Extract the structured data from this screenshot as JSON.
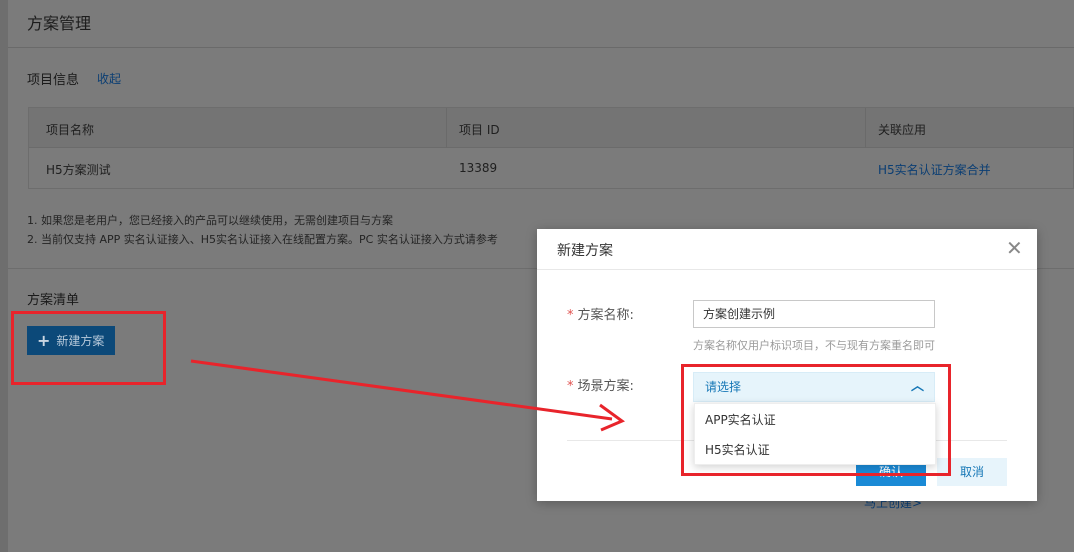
{
  "page": {
    "title": "方案管理",
    "project_section_title": "项目信息",
    "collapse_label": "收起",
    "project_table": {
      "headers": [
        "项目名称",
        "项目 ID",
        "关联应用"
      ],
      "rows": [
        {
          "name": "H5方案测试",
          "id": "13389",
          "app": "H5实名认证方案合并"
        }
      ]
    },
    "notes": [
      "1. 如果您是老用户，您已经接入的产品可以继续使用，无需创建项目与方案",
      "2. 当前仅支持 APP 实名认证接入、H5实名认证接入在线配置方案。PC 实名认证接入方式请参考"
    ],
    "plan_list_title": "方案清单",
    "new_plan_button": "新建方案",
    "bottom_link": "马上创建>"
  },
  "modal": {
    "title": "新建方案",
    "close_icon": "close-icon",
    "name_label": "方案名称:",
    "name_value": "方案创建示例",
    "name_hint": "方案名称仅用户标识项目，不与现有方案重名即可",
    "scene_label": "场景方案:",
    "scene_placeholder": "请选择",
    "ok_label": "确认",
    "cancel_label": "取消"
  },
  "dropdown": {
    "options": [
      "APP实名认证",
      "H5实名认证"
    ]
  },
  "colors": {
    "annotation_red": "#e8242b",
    "link_blue": "#1677b6",
    "primary_button": "#1a8ad6"
  }
}
